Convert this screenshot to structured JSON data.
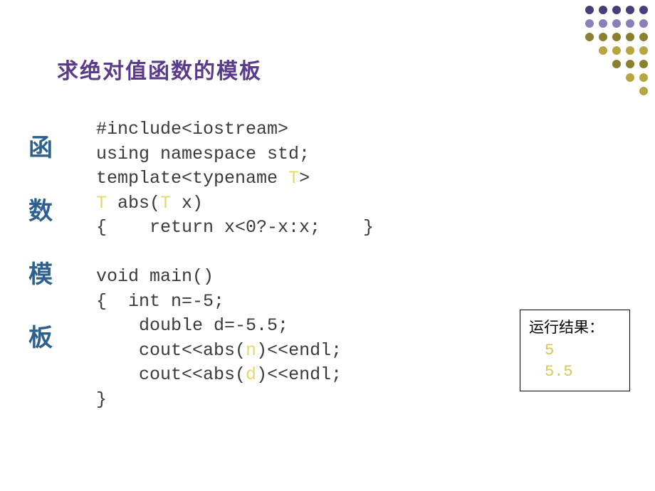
{
  "title": "求绝对值函数的模板",
  "sidebar": {
    "chars": [
      "函",
      "数",
      "模",
      "板"
    ]
  },
  "code": {
    "line1": "#include<iostream>",
    "line2": "using namespace std;",
    "line3_a": "template<typename ",
    "line3_t": "T",
    "line3_b": ">",
    "line4_t1": "T",
    "line4_a": " abs(",
    "line4_t2": "T",
    "line4_b": " x)",
    "line5": "{    return x<0?-x:x;    }",
    "line6": "",
    "line7": "void main()",
    "line8": "{  int n=-5;",
    "line9": "    double d=-5.5;",
    "line10_a": "    cout<<abs(",
    "line10_v": "n",
    "line10_b": ")<<endl;",
    "line11_a": "    cout<<abs(",
    "line11_v": "d",
    "line11_b": ")<<endl;",
    "line12": "}"
  },
  "result": {
    "label": "运行结果：",
    "val1": "5",
    "val2": "5.5"
  }
}
